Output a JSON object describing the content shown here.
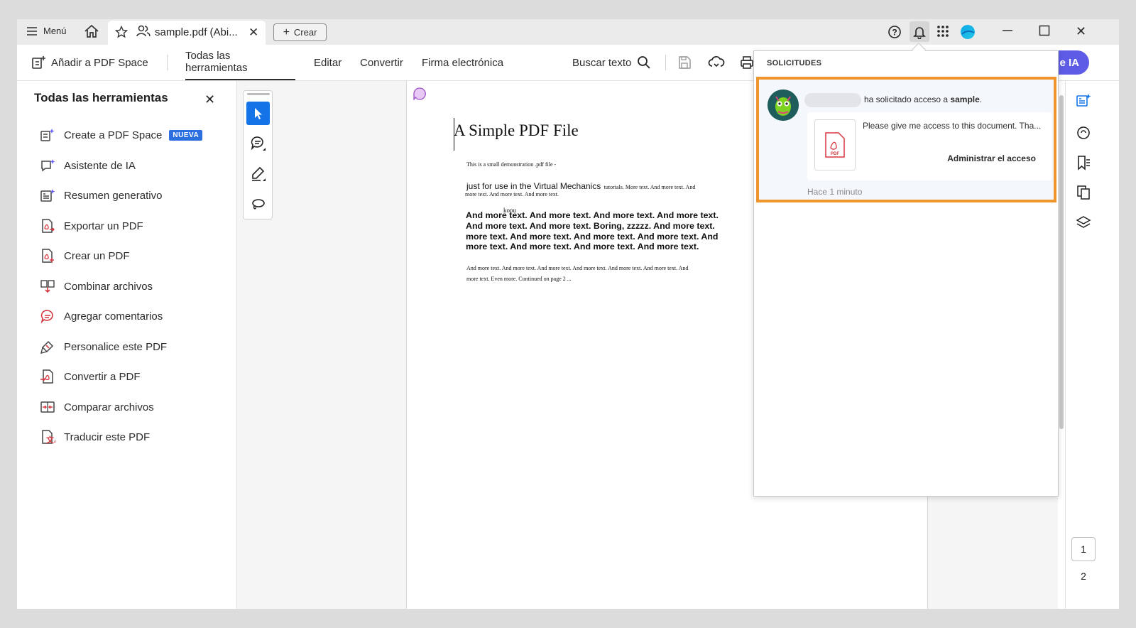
{
  "titlebar": {
    "menu_label": "Menú",
    "tab_title": "sample.pdf (Abi...",
    "create_label": "Crear"
  },
  "toolbar": {
    "add_space": "Añadir a PDF Space",
    "nav": [
      "Todas las herramientas",
      "Editar",
      "Convertir",
      "Firma electrónica"
    ],
    "search_label": "Buscar texto",
    "ai_button": "e IA"
  },
  "sidepanel": {
    "title": "Todas las herramientas",
    "badge": "NUEVA",
    "tools": [
      {
        "label": "Create a PDF Space",
        "icon": "pdf-space-icon"
      },
      {
        "label": "Asistente de IA",
        "icon": "ai-assistant-icon"
      },
      {
        "label": "Resumen generativo",
        "icon": "generative-summary-icon"
      },
      {
        "label": "Exportar un PDF",
        "icon": "export-pdf-icon"
      },
      {
        "label": "Crear un PDF",
        "icon": "create-pdf-icon"
      },
      {
        "label": "Combinar archivos",
        "icon": "combine-files-icon"
      },
      {
        "label": "Agregar comentarios",
        "icon": "comment-icon"
      },
      {
        "label": "Personalice este PDF",
        "icon": "customize-icon"
      },
      {
        "label": "Convertir a PDF",
        "icon": "convert-pdf-icon"
      },
      {
        "label": "Comparar archivos",
        "icon": "compare-files-icon"
      },
      {
        "label": "Traducir este PDF",
        "icon": "translate-icon"
      }
    ]
  },
  "document": {
    "title": "A Simple PDF File",
    "line1": "This is a small demonstration .pdf file -",
    "line2a": "just for use in the Virtual Mechanics",
    "line2b": "tutorials. More text. And more  text. And",
    "line3": "more text. And more text. And more text.",
    "overlay": "kopu",
    "bold1": "And more text. And more text. And more text. And more text.",
    "bold2": "And more  text. And more text. Boring, zzzzz. And more text.",
    "bold3": "more text. And  more text. And more text. And more text. And",
    "bold4": "more text. And more text.  And more text. And more text.",
    "small1": "And more text. And more text. And more text. And more text. And more  text. And more text. And",
    "small2": "more text. Even more. Continued on page 2 ..."
  },
  "popup": {
    "header": "SOLICITUDES",
    "request_text": "ha solicitado acceso a",
    "request_doc": "sample",
    "request_suffix": ".",
    "message": "Please give me access to this document. Tha...",
    "file_type": "PDF",
    "manage": "Administrar el acceso",
    "time": "Hace 1 minuto"
  },
  "pages": [
    "1",
    "2"
  ],
  "colors": {
    "accent_blue": "#1473e6",
    "highlight_orange": "#f0952b",
    "badge_blue": "#2d6fe0",
    "pdf_red": "#d7373f"
  }
}
